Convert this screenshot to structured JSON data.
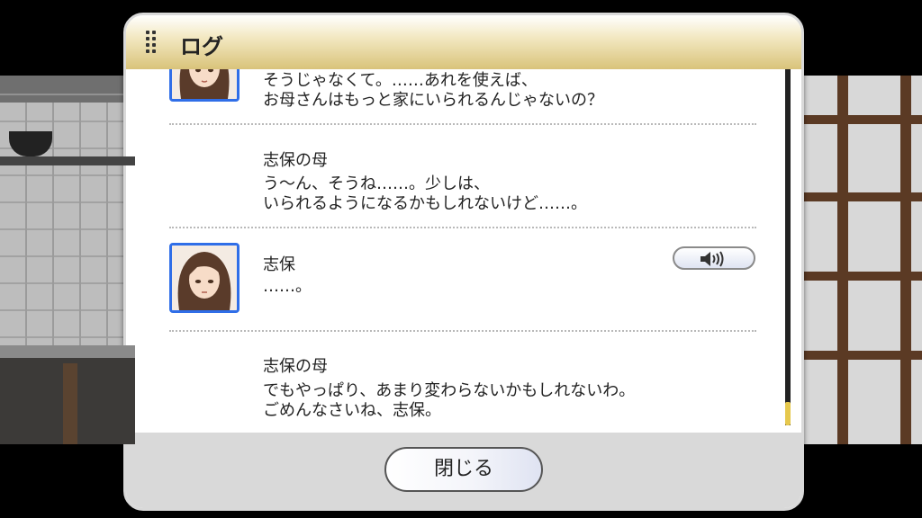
{
  "panel": {
    "title": "ログ"
  },
  "entries": [
    {
      "speaker": "",
      "lines": [
        "そうじゃなくて。……あれを使えば、",
        "お母さんはもっと家にいられるんじゃないの？"
      ],
      "has_avatar": true
    },
    {
      "speaker": "志保の母",
      "lines": [
        "う～ん、そうね……。少しは、",
        "いられるようになるかもしれないけど……。"
      ],
      "has_avatar": false
    },
    {
      "speaker": "志保",
      "lines": [
        "……。"
      ],
      "has_avatar": true,
      "has_voice": true
    },
    {
      "speaker": "志保の母",
      "lines": [
        "でもやっぱり、あまり変わらないかもしれないわ。",
        "ごめんなさいね、志保。"
      ],
      "has_avatar": false
    }
  ],
  "footer": {
    "close_label": "閉じる"
  },
  "icons": {
    "menu": "dots-grip-icon",
    "voice": "speaker-icon"
  },
  "colors": {
    "header_gold": "#d9c37a",
    "avatar_border": "#2f6ee8",
    "scroll_thumb": "#e6c84d"
  }
}
